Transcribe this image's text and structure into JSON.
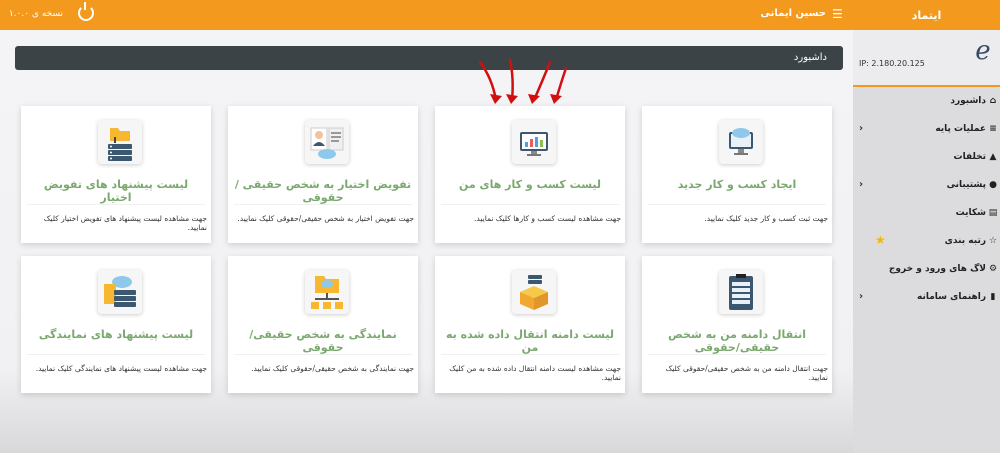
{
  "topbar": {
    "brand": "ایتماد",
    "menu_icon": "☰",
    "user_name": "حسین ایمانی",
    "version": "نسخه ی ۱.۰.۰"
  },
  "sidebar": {
    "ip": "IP: 2.180.20.125",
    "items": [
      {
        "label": "داشبورد",
        "icon": "home-icon",
        "chevron": false
      },
      {
        "label": "عملیات پایه",
        "icon": "list-icon",
        "chevron": true
      },
      {
        "label": "تخلفات",
        "icon": "warning-icon",
        "chevron": false
      },
      {
        "label": "پشتیبانی",
        "icon": "chat-icon",
        "chevron": true
      },
      {
        "label": "شکایت",
        "icon": "document-icon",
        "chevron": false
      },
      {
        "label": "رتبه بندی",
        "icon": "star-icon",
        "chevron": false
      },
      {
        "label": "لاگ های ورود و خروج",
        "icon": "gear-icon",
        "chevron": false
      },
      {
        "label": "راهنمای سامانه",
        "icon": "book-icon",
        "chevron": true
      }
    ]
  },
  "breadcrumb": "داشبورد",
  "cards": [
    {
      "title": "ایجاد کسب و کار جدید",
      "desc": "جهت ثبت کسب و کار جدید کلیک نمایید.",
      "icon": "monitor-cloud-icon"
    },
    {
      "title": "لیست کسب و کار های من",
      "desc": "جهت مشاهده لیست کسب و کارها کلیک نمایید.",
      "icon": "monitor-chart-icon"
    },
    {
      "title": "تفویض اختیار به شخص حقیقی / حقوقی",
      "desc": "جهت تفویض اختیار به شخص حقیقی/حقوقی کلیک نمایید.",
      "icon": "user-document-icon"
    },
    {
      "title": "لیست پیشنهاد های تفویض اختیار",
      "desc": "جهت مشاهده لیست پیشنهاد های تفویض اختیار کلیک نمایید.",
      "icon": "folder-server-icon"
    },
    {
      "title": "انتقال دامنه من به شخص حقیقی/حقوقی",
      "desc": "جهت انتقال دامنه من به شخص حقیقی/حقوقی کلیک نمایید.",
      "icon": "clipboard-icon"
    },
    {
      "title": "لیست دامنه انتقال داده شده به من",
      "desc": "جهت مشاهده لیست دامنه انتقال داده شده به من کلیک نمایید.",
      "icon": "box-icon"
    },
    {
      "title": "نمایندگی به شخص حقیقی/حقوقی",
      "desc": "جهت نمایندگی به شخص حقیقی/حقوقی کلیک نمایید.",
      "icon": "folder-network-icon"
    },
    {
      "title": "لیست پیشنهاد های نمایندگی",
      "desc": "جهت مشاهده لیست پیشنهاد های نمایندگی کلیک نمایید.",
      "icon": "cloud-server-icon"
    }
  ]
}
